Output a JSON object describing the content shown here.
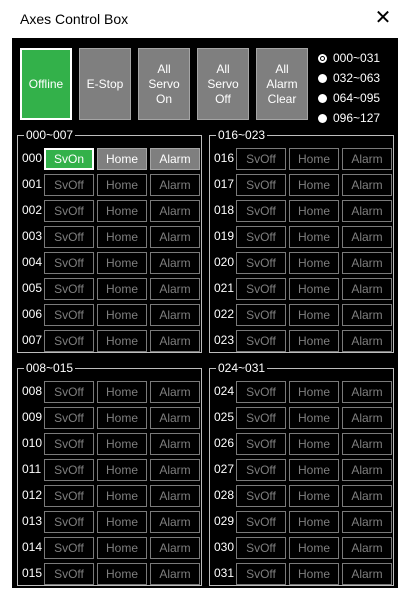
{
  "window": {
    "title": "Axes Control Box",
    "close_glyph": "✕"
  },
  "top_buttons": [
    {
      "name": "offline-button",
      "label": "Offline",
      "active": true
    },
    {
      "name": "estop-button",
      "label": "E-Stop",
      "active": false
    },
    {
      "name": "all-servo-on-button",
      "label": "All\nServo\nOn",
      "active": false
    },
    {
      "name": "all-servo-off-button",
      "label": "All\nServo\nOff",
      "active": false
    },
    {
      "name": "all-alarm-clear-button",
      "label": "All\nAlarm\nClear",
      "active": false
    }
  ],
  "ranges": [
    {
      "label": "000~031",
      "selected": true
    },
    {
      "label": "032~063",
      "selected": false
    },
    {
      "label": "064~095",
      "selected": false
    },
    {
      "label": "096~127",
      "selected": false
    }
  ],
  "groups": [
    {
      "label": "000~007",
      "axes": [
        {
          "num": "000",
          "servo": "SvOn",
          "servo_on": true,
          "home": "Home",
          "alarm": "Alarm",
          "lit": true
        },
        {
          "num": "001",
          "servo": "SvOff",
          "servo_on": false,
          "home": "Home",
          "alarm": "Alarm",
          "lit": false
        },
        {
          "num": "002",
          "servo": "SvOff",
          "servo_on": false,
          "home": "Home",
          "alarm": "Alarm",
          "lit": false
        },
        {
          "num": "003",
          "servo": "SvOff",
          "servo_on": false,
          "home": "Home",
          "alarm": "Alarm",
          "lit": false
        },
        {
          "num": "004",
          "servo": "SvOff",
          "servo_on": false,
          "home": "Home",
          "alarm": "Alarm",
          "lit": false
        },
        {
          "num": "005",
          "servo": "SvOff",
          "servo_on": false,
          "home": "Home",
          "alarm": "Alarm",
          "lit": false
        },
        {
          "num": "006",
          "servo": "SvOff",
          "servo_on": false,
          "home": "Home",
          "alarm": "Alarm",
          "lit": false
        },
        {
          "num": "007",
          "servo": "SvOff",
          "servo_on": false,
          "home": "Home",
          "alarm": "Alarm",
          "lit": false
        }
      ]
    },
    {
      "label": "016~023",
      "axes": [
        {
          "num": "016",
          "servo": "SvOff",
          "servo_on": false,
          "home": "Home",
          "alarm": "Alarm",
          "lit": false
        },
        {
          "num": "017",
          "servo": "SvOff",
          "servo_on": false,
          "home": "Home",
          "alarm": "Alarm",
          "lit": false
        },
        {
          "num": "018",
          "servo": "SvOff",
          "servo_on": false,
          "home": "Home",
          "alarm": "Alarm",
          "lit": false
        },
        {
          "num": "019",
          "servo": "SvOff",
          "servo_on": false,
          "home": "Home",
          "alarm": "Alarm",
          "lit": false
        },
        {
          "num": "020",
          "servo": "SvOff",
          "servo_on": false,
          "home": "Home",
          "alarm": "Alarm",
          "lit": false
        },
        {
          "num": "021",
          "servo": "SvOff",
          "servo_on": false,
          "home": "Home",
          "alarm": "Alarm",
          "lit": false
        },
        {
          "num": "022",
          "servo": "SvOff",
          "servo_on": false,
          "home": "Home",
          "alarm": "Alarm",
          "lit": false
        },
        {
          "num": "023",
          "servo": "SvOff",
          "servo_on": false,
          "home": "Home",
          "alarm": "Alarm",
          "lit": false
        }
      ]
    },
    {
      "label": "008~015",
      "axes": [
        {
          "num": "008",
          "servo": "SvOff",
          "servo_on": false,
          "home": "Home",
          "alarm": "Alarm",
          "lit": false
        },
        {
          "num": "009",
          "servo": "SvOff",
          "servo_on": false,
          "home": "Home",
          "alarm": "Alarm",
          "lit": false
        },
        {
          "num": "010",
          "servo": "SvOff",
          "servo_on": false,
          "home": "Home",
          "alarm": "Alarm",
          "lit": false
        },
        {
          "num": "011",
          "servo": "SvOff",
          "servo_on": false,
          "home": "Home",
          "alarm": "Alarm",
          "lit": false
        },
        {
          "num": "012",
          "servo": "SvOff",
          "servo_on": false,
          "home": "Home",
          "alarm": "Alarm",
          "lit": false
        },
        {
          "num": "013",
          "servo": "SvOff",
          "servo_on": false,
          "home": "Home",
          "alarm": "Alarm",
          "lit": false
        },
        {
          "num": "014",
          "servo": "SvOff",
          "servo_on": false,
          "home": "Home",
          "alarm": "Alarm",
          "lit": false
        },
        {
          "num": "015",
          "servo": "SvOff",
          "servo_on": false,
          "home": "Home",
          "alarm": "Alarm",
          "lit": false
        }
      ]
    },
    {
      "label": "024~031",
      "axes": [
        {
          "num": "024",
          "servo": "SvOff",
          "servo_on": false,
          "home": "Home",
          "alarm": "Alarm",
          "lit": false
        },
        {
          "num": "025",
          "servo": "SvOff",
          "servo_on": false,
          "home": "Home",
          "alarm": "Alarm",
          "lit": false
        },
        {
          "num": "026",
          "servo": "SvOff",
          "servo_on": false,
          "home": "Home",
          "alarm": "Alarm",
          "lit": false
        },
        {
          "num": "027",
          "servo": "SvOff",
          "servo_on": false,
          "home": "Home",
          "alarm": "Alarm",
          "lit": false
        },
        {
          "num": "028",
          "servo": "SvOff",
          "servo_on": false,
          "home": "Home",
          "alarm": "Alarm",
          "lit": false
        },
        {
          "num": "029",
          "servo": "SvOff",
          "servo_on": false,
          "home": "Home",
          "alarm": "Alarm",
          "lit": false
        },
        {
          "num": "030",
          "servo": "SvOff",
          "servo_on": false,
          "home": "Home",
          "alarm": "Alarm",
          "lit": false
        },
        {
          "num": "031",
          "servo": "SvOff",
          "servo_on": false,
          "home": "Home",
          "alarm": "Alarm",
          "lit": false
        }
      ]
    }
  ],
  "colors": {
    "active_green": "#33b14a",
    "panel_bg": "#000000",
    "button_gray": "#7f7f7f",
    "border_gray": "#7a7a7a"
  }
}
